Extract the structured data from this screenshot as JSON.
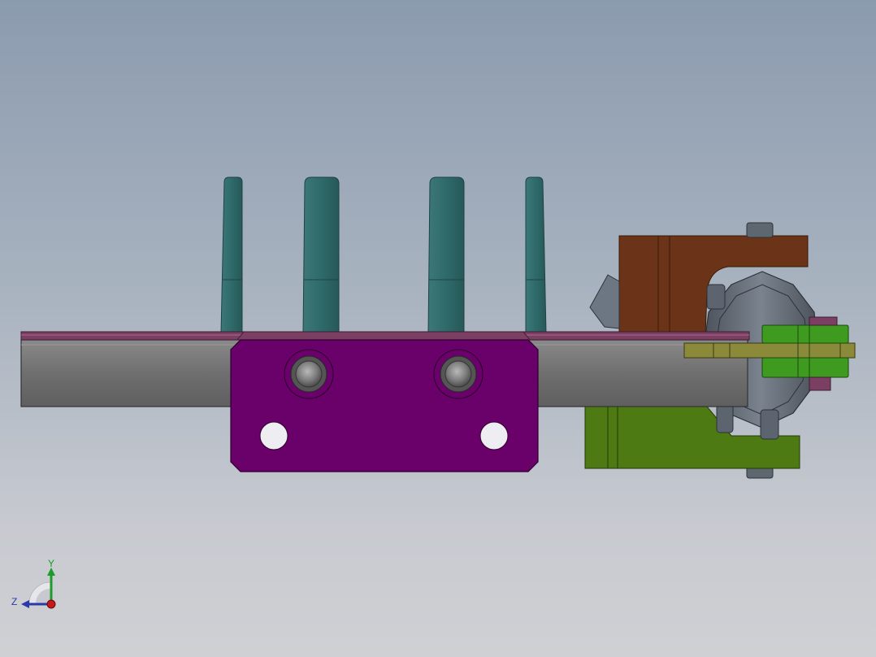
{
  "viewport": {
    "background_top": "#8b9bae",
    "background_bottom": "#cfd0d4"
  },
  "model": {
    "colors": {
      "rail": "#707070",
      "rail_edge": "#3c3c3c",
      "strip": "#7a3f62",
      "carriage_plate": "#6a0069",
      "fingers": "#2f6666",
      "bracket_top": "#6b3418",
      "bracket_bottom": "#4e7a13",
      "pin": "#8a8a3a",
      "gear": "#5c6470",
      "clamp": "#3f9a20"
    }
  },
  "triad": {
    "y_label": "Y",
    "z_label": "Z",
    "y_color": "#1f9a2c",
    "z_color": "#2a3aa8",
    "x_color": "#c41a1a"
  }
}
